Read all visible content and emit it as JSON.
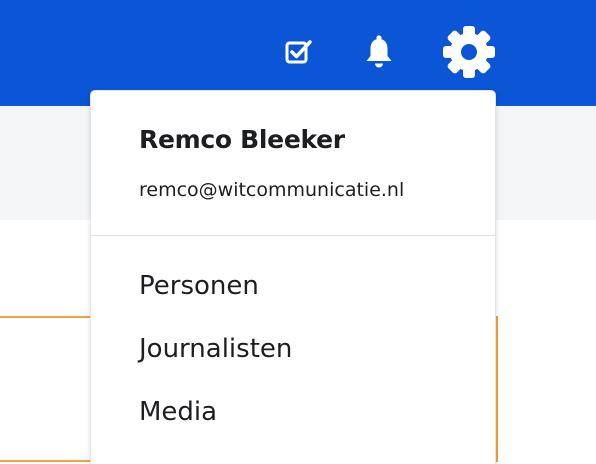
{
  "header": {
    "background_color": "#0a56d6",
    "icons": [
      "tasks-check-icon",
      "bell-icon",
      "gear-icon"
    ]
  },
  "user_menu": {
    "name": "Remco Bleeker",
    "email": "remco@witcommunicatie.nl",
    "items": [
      {
        "label": "Personen"
      },
      {
        "label": "Journalisten"
      },
      {
        "label": "Media"
      }
    ]
  },
  "colors": {
    "accent_orange": "#f0a23b",
    "subbar_gray": "#f4f5f7"
  }
}
